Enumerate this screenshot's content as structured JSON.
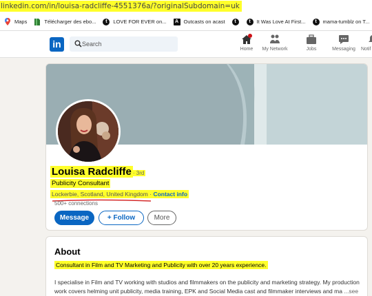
{
  "browser": {
    "url": "linkedin.com/in/louisa-radcliffe-4551376a/?originalSubdomain=uk"
  },
  "bookmarks": [
    {
      "label": "Maps",
      "icon": "map-pin-icon"
    },
    {
      "label": "Télécharger des ebo...",
      "icon": "book-icon"
    },
    {
      "label": "LOVE FOR EVER on...",
      "icon": "tumblr-icon"
    },
    {
      "label": "Outcasts on acast",
      "icon": "acast-icon"
    },
    {
      "label": "",
      "icon": "tumblr-icon"
    },
    {
      "label": "It Was Love At First...",
      "icon": "tumblr-icon"
    },
    {
      "label": "mama-tumblz on T...",
      "icon": "tumblr-icon"
    }
  ],
  "nav": {
    "logo": "in",
    "search_placeholder": "Search",
    "items": [
      {
        "label": "Home",
        "icon": "home-icon"
      },
      {
        "label": "My Network",
        "icon": "network-icon"
      },
      {
        "label": "Jobs",
        "icon": "briefcase-icon"
      },
      {
        "label": "Messaging",
        "icon": "message-icon"
      },
      {
        "label": "Notif",
        "icon": "bell-icon"
      }
    ]
  },
  "profile": {
    "name": "Louisa Radcliffe",
    "degree": "· 3rd",
    "headline": "Publicity Consultant",
    "location": "Lockerbie, Scotland, United Kingdom",
    "location_sep": " · ",
    "contact_info": "Contact info",
    "connections": "500+ connections",
    "buttons": {
      "message": "Message",
      "follow": "+ Follow",
      "more": "More"
    }
  },
  "about": {
    "title": "About",
    "highlight": "Consultant in Film and TV Marketing and Publicity with over 20 years experience.",
    "body": "I specialise in Film and TV working with studios and filmmakers on the publicity and marketing strategy. My production work covers helming unit publicity, media training, EPK and Social Media cast and filmmaker interviews and ma",
    "see_more": " ...see more"
  },
  "colors": {
    "highlight": "#ffff2a",
    "brand": "#0a66c2",
    "annotation_underline": "#d42a2a",
    "banner_light": "#c3d4d7",
    "banner_mid": "#9db3b7"
  }
}
